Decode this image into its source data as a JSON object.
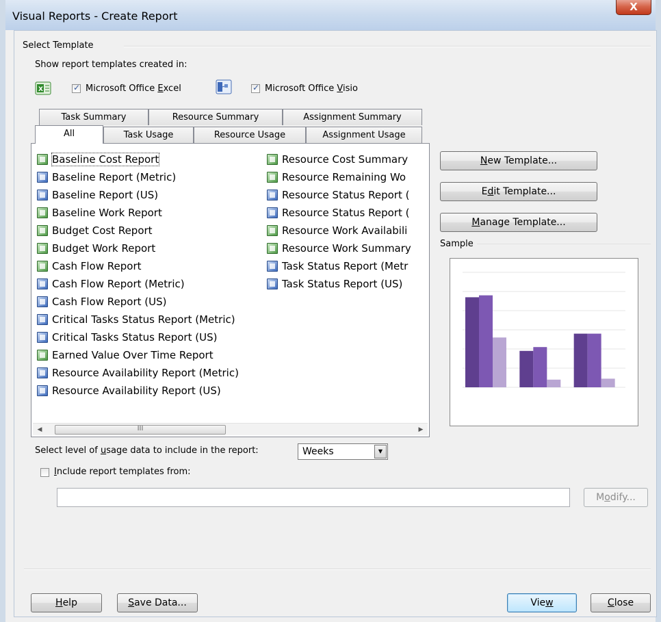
{
  "window": {
    "title": "Visual Reports - Create Report",
    "close_glyph": "X"
  },
  "select_template": {
    "group_label": "Select Template",
    "show_label": "Show report templates created in:",
    "excel": {
      "label_pre": "Microsoft Office ",
      "label_ul": "E",
      "label_post": "xcel",
      "checked": true
    },
    "visio": {
      "label_pre": "Microsoft Office ",
      "label_ul": "V",
      "label_post": "isio",
      "checked": true
    }
  },
  "tabs": {
    "row_back": [
      "Task Summary",
      "Resource Summary",
      "Assignment Summary"
    ],
    "row_front": [
      "All",
      "Task Usage",
      "Resource Usage",
      "Assignment Usage"
    ],
    "active": "All"
  },
  "reports": {
    "col1": [
      {
        "label": "Baseline Cost Report",
        "type": "excel"
      },
      {
        "label": "Baseline Report (Metric)",
        "type": "visio"
      },
      {
        "label": "Baseline Report (US)",
        "type": "visio"
      },
      {
        "label": "Baseline Work Report",
        "type": "excel"
      },
      {
        "label": "Budget Cost Report",
        "type": "excel"
      },
      {
        "label": "Budget Work Report",
        "type": "excel"
      },
      {
        "label": "Cash Flow Report",
        "type": "excel"
      },
      {
        "label": "Cash Flow Report (Metric)",
        "type": "visio"
      },
      {
        "label": "Cash Flow Report (US)",
        "type": "visio"
      },
      {
        "label": "Critical Tasks Status Report (Metric)",
        "type": "visio"
      },
      {
        "label": "Critical Tasks Status Report (US)",
        "type": "visio"
      },
      {
        "label": "Earned Value Over Time Report",
        "type": "excel"
      },
      {
        "label": "Resource Availability Report (Metric)",
        "type": "visio"
      },
      {
        "label": "Resource Availability Report (US)",
        "type": "visio"
      }
    ],
    "col2": [
      {
        "label": "Resource Cost Summary",
        "type": "excel"
      },
      {
        "label": "Resource Remaining Wo",
        "type": "excel"
      },
      {
        "label": "Resource Status Report (",
        "type": "visio"
      },
      {
        "label": "Resource Status Report (",
        "type": "visio"
      },
      {
        "label": "Resource Work Availabili",
        "type": "excel"
      },
      {
        "label": "Resource Work Summary",
        "type": "excel"
      },
      {
        "label": "Task Status Report (Metr",
        "type": "visio"
      },
      {
        "label": "Task Status Report (US)",
        "type": "visio"
      }
    ],
    "scroll_grip": "III"
  },
  "buttons": {
    "new_template": {
      "pre": "",
      "ul": "N",
      "post": "ew Template..."
    },
    "edit_template": {
      "pre": "E",
      "ul": "d",
      "post": "it Template..."
    },
    "manage_template": {
      "pre": "",
      "ul": "M",
      "post": "anage Template..."
    },
    "modify": {
      "pre": "M",
      "ul": "o",
      "post": "dify..."
    },
    "help": {
      "pre": "",
      "ul": "H",
      "post": "elp"
    },
    "save_data": {
      "pre": "",
      "ul": "S",
      "post": "ave Data..."
    },
    "view": {
      "pre": "Vie",
      "ul": "w",
      "post": ""
    },
    "close": {
      "pre": "",
      "ul": "C",
      "post": "lose"
    }
  },
  "sample": {
    "label": "Sample",
    "chart_data": {
      "type": "bar",
      "categories": [
        "",
        "",
        ""
      ],
      "series": [
        {
          "values": [
            94,
            38,
            56
          ],
          "color": "#5f3f8f"
        },
        {
          "values": [
            96,
            42,
            56
          ],
          "color": "#7d58b3"
        },
        {
          "values": [
            52,
            8,
            9
          ],
          "color": "#b9a6d3"
        }
      ],
      "ylim": [
        0,
        120
      ],
      "grid": true
    }
  },
  "usage": {
    "label_pre": "Select level of ",
    "label_ul": "u",
    "label_post": "sage data to include in the report:",
    "selected": "Weeks"
  },
  "include": {
    "label_pre": "",
    "label_ul": "I",
    "label_post": "nclude report templates from:",
    "checked": false,
    "path_value": ""
  }
}
